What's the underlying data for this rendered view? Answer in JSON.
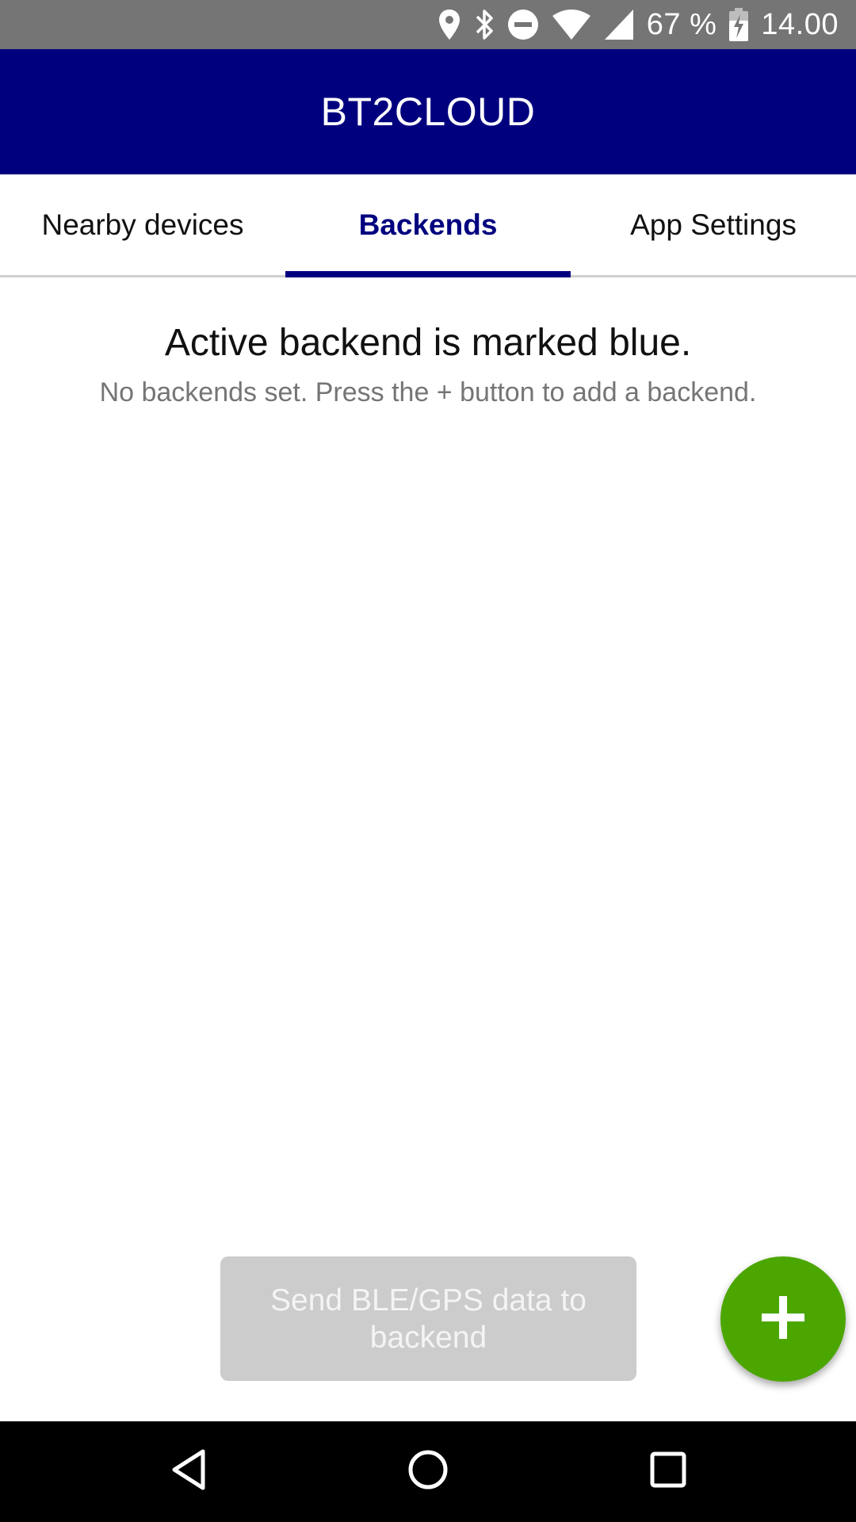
{
  "status_bar": {
    "battery_percent": "67 %",
    "time": "14.00",
    "icons": [
      "location-icon",
      "bluetooth-icon",
      "do-not-disturb-icon",
      "wifi-icon",
      "cell-signal-icon",
      "battery-charging-icon"
    ]
  },
  "app_bar": {
    "title": "BT2CLOUD"
  },
  "tabs": [
    {
      "label": "Nearby devices",
      "active": false
    },
    {
      "label": "Backends",
      "active": true
    },
    {
      "label": "App Settings",
      "active": false
    }
  ],
  "main": {
    "heading": "Active backend is marked blue.",
    "empty_message": "No backends set. Press the + button to add a backend."
  },
  "send_button": {
    "label": "Send BLE/GPS data to backend",
    "enabled": false
  },
  "fab": {
    "icon": "plus-icon"
  },
  "nav_bar": {
    "icons": [
      "back-icon",
      "home-icon",
      "recent-apps-icon"
    ]
  },
  "colors": {
    "primary": "#00007f",
    "accent": "#4ca600",
    "status_bar": "#757575",
    "disabled_button": "#cccccc"
  }
}
